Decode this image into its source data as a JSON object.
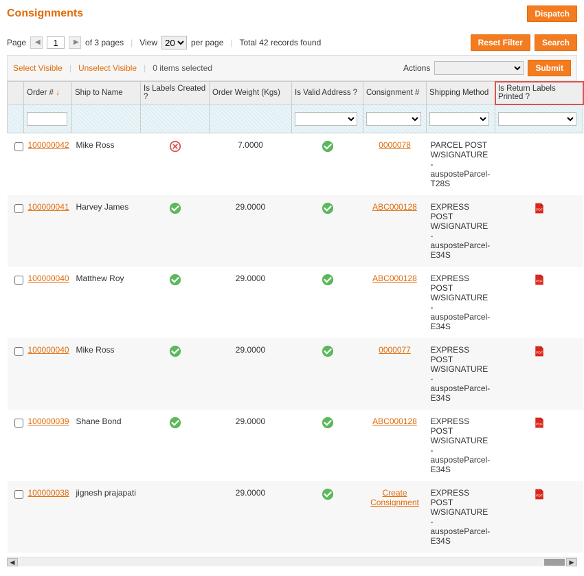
{
  "header": {
    "title": "Consignments",
    "dispatch": "Dispatch"
  },
  "paging": {
    "page_label": "Page",
    "page": "1",
    "total_pages_text": "of 3 pages",
    "view_label": "View",
    "per_page": "20",
    "per_page_label": "per page",
    "total_records_text": "Total 42 records found"
  },
  "buttons": {
    "reset_filter": "Reset Filter",
    "search": "Search",
    "submit": "Submit"
  },
  "actionbar": {
    "select_visible": "Select Visible",
    "unselect_visible": "Unselect Visible",
    "items_selected": "0 items selected",
    "actions_label": "Actions"
  },
  "columns": {
    "order": "Order #",
    "ship_to": "Ship to Name",
    "labels_created": "Is Labels Created ?",
    "order_weight": "Order Weight (Kgs)",
    "valid_address": "Is Valid Address ?",
    "consignment": "Consignment #",
    "shipping_method": "Shipping Method",
    "return_labels": "Is Return Labels Printed ?"
  },
  "rows": [
    {
      "order": "100000042",
      "name": "Mike Ross",
      "labels": "no",
      "weight": "7.0000",
      "valid": "yes",
      "cons": "0000078",
      "cons_type": "link",
      "ship": "PARCEL POST W/SIGNATURE - ausposteParcel-T28S",
      "pdf": false
    },
    {
      "order": "100000041",
      "name": "Harvey James",
      "labels": "yes",
      "weight": "29.0000",
      "valid": "yes",
      "cons": "ABC000128",
      "cons_type": "link",
      "ship": "EXPRESS POST W/SIGNATURE - ausposteParcel-E34S",
      "pdf": true
    },
    {
      "order": "100000040",
      "name": "Matthew Roy",
      "labels": "yes",
      "weight": "29.0000",
      "valid": "yes",
      "cons": "ABC000128",
      "cons_type": "link",
      "ship": "EXPRESS POST W/SIGNATURE - ausposteParcel-E34S",
      "pdf": true
    },
    {
      "order": "100000040",
      "name": "Mike Ross",
      "labels": "yes",
      "weight": "29.0000",
      "valid": "yes",
      "cons": "0000077",
      "cons_type": "link",
      "ship": "EXPRESS POST W/SIGNATURE - ausposteParcel-E34S",
      "pdf": true
    },
    {
      "order": "100000039",
      "name": "Shane Bond",
      "labels": "yes",
      "weight": "29.0000",
      "valid": "yes",
      "cons": "ABC000128",
      "cons_type": "link",
      "ship": "EXPRESS POST W/SIGNATURE - ausposteParcel-E34S",
      "pdf": true
    },
    {
      "order": "100000038",
      "name": "jignesh prajapati",
      "labels": "",
      "weight": "29.0000",
      "valid": "yes",
      "cons": "Create Consignment",
      "cons_type": "action",
      "ship": "EXPRESS POST W/SIGNATURE - ausposteParcel-E34S",
      "pdf": true
    }
  ]
}
